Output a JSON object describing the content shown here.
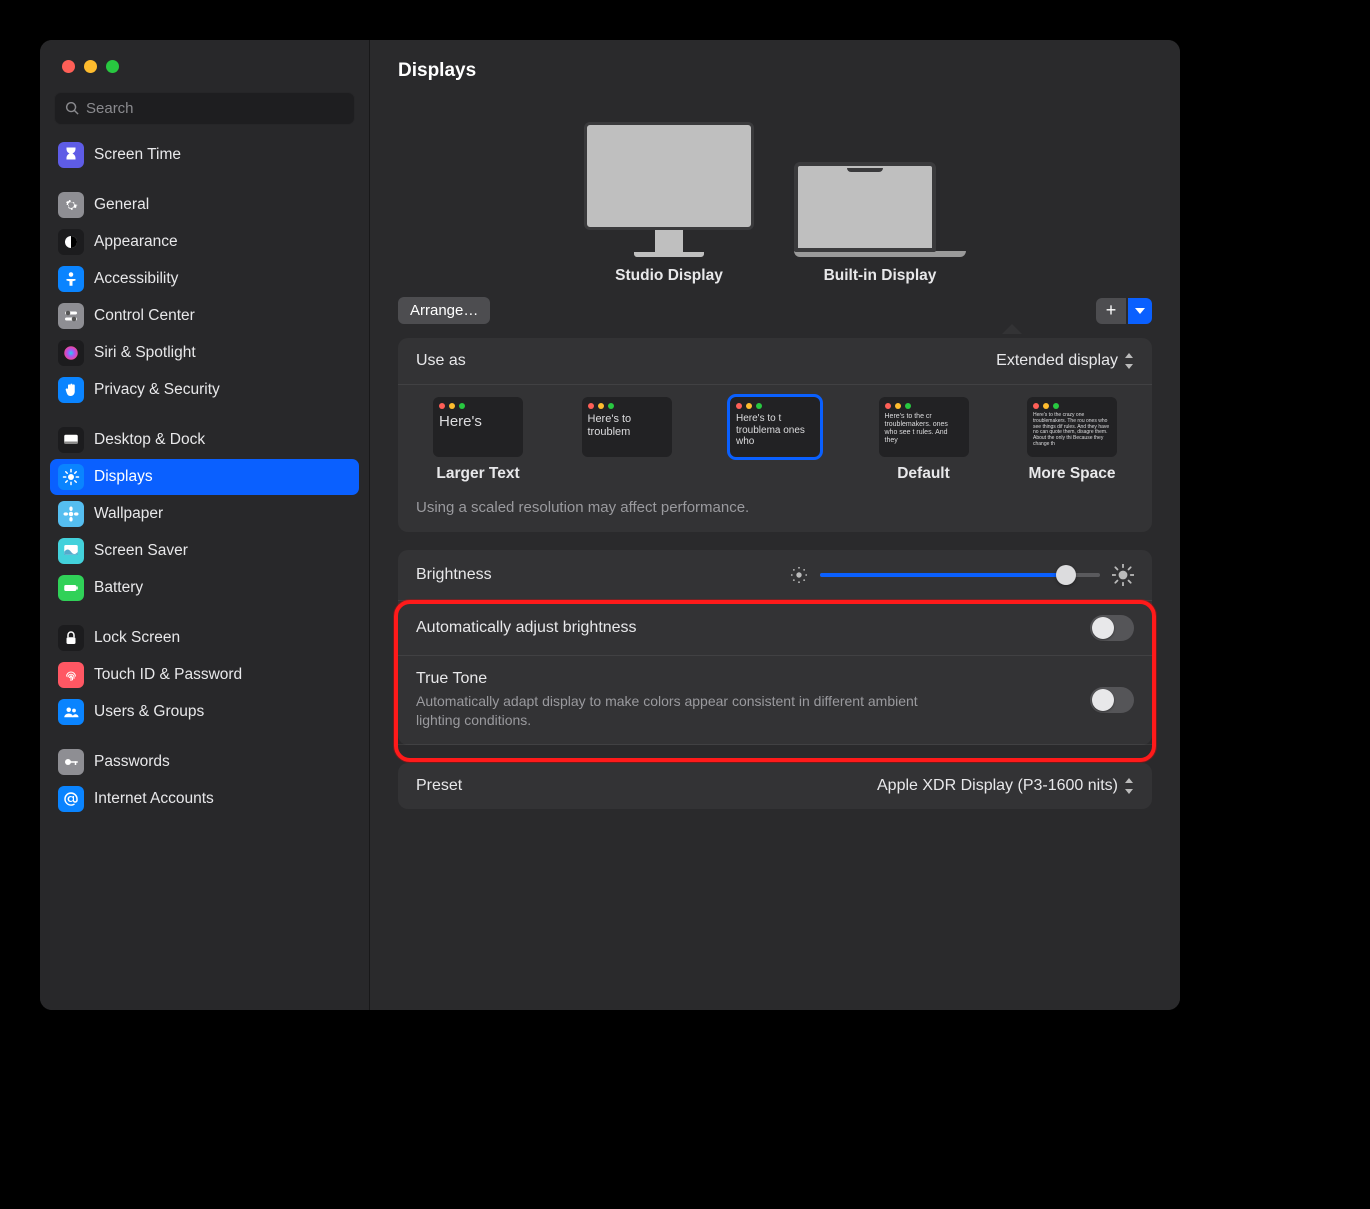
{
  "window": {
    "title": "Displays"
  },
  "search": {
    "placeholder": "Search"
  },
  "sidebar": {
    "groups": [
      {
        "items": [
          {
            "label": "Screen Time",
            "icon": "hourglass",
            "bg": "#5e5ce6"
          }
        ]
      },
      {
        "items": [
          {
            "label": "General",
            "icon": "gear",
            "bg": "#8e8e93"
          },
          {
            "label": "Appearance",
            "icon": "contrast",
            "bg": "#1c1c1e"
          },
          {
            "label": "Accessibility",
            "icon": "figure",
            "bg": "#0a84ff"
          },
          {
            "label": "Control Center",
            "icon": "switches",
            "bg": "#8e8e93"
          },
          {
            "label": "Siri & Spotlight",
            "icon": "siri",
            "bg": "#1c1c1e"
          },
          {
            "label": "Privacy & Security",
            "icon": "hand",
            "bg": "#0a84ff"
          }
        ]
      },
      {
        "items": [
          {
            "label": "Desktop & Dock",
            "icon": "dock",
            "bg": "#1c1c1e"
          },
          {
            "label": "Displays",
            "icon": "brightness",
            "bg": "#0a84ff",
            "selected": true
          },
          {
            "label": "Wallpaper",
            "icon": "flower",
            "bg": "#55bef0"
          },
          {
            "label": "Screen Saver",
            "icon": "screensaver",
            "bg": "#43d1db"
          },
          {
            "label": "Battery",
            "icon": "battery",
            "bg": "#30d158"
          }
        ]
      },
      {
        "items": [
          {
            "label": "Lock Screen",
            "icon": "lock",
            "bg": "#1c1c1e"
          },
          {
            "label": "Touch ID & Password",
            "icon": "fingerprint",
            "bg": "#ff5763"
          },
          {
            "label": "Users & Groups",
            "icon": "users",
            "bg": "#0a84ff"
          }
        ]
      },
      {
        "items": [
          {
            "label": "Passwords",
            "icon": "key",
            "bg": "#8e8e93"
          },
          {
            "label": "Internet Accounts",
            "icon": "at",
            "bg": "#0a84ff"
          }
        ]
      }
    ]
  },
  "displays": {
    "arrange": "Arrange…",
    "items": [
      {
        "name": "Studio Display",
        "type": "monitor"
      },
      {
        "name": "Built-in Display",
        "type": "laptop",
        "selected": true
      }
    ],
    "useAs": {
      "label": "Use as",
      "value": "Extended display"
    },
    "resolutions": {
      "options": [
        {
          "text": "Here's",
          "label": "Larger Text",
          "fs": 15
        },
        {
          "text": "Here's to troublem",
          "label": "",
          "fs": 11
        },
        {
          "text": "Here's to t troublema ones who",
          "label": "",
          "fs": 10,
          "selected": true
        },
        {
          "text": "Here's to the cr troublemakers. ones who see t rules. And they",
          "label": "Default",
          "fs": 7
        },
        {
          "text": "Here's to the crazy one troublemakers. The rou ones who see things dif rules. And they have no can quote them, disagre them. About the only thi Because they change th",
          "label": "More Space",
          "fs": 5
        }
      ],
      "hint": "Using a scaled resolution may affect performance."
    },
    "brightness": {
      "label": "Brightness",
      "value": 88
    },
    "autoBrightness": {
      "label": "Automatically adjust brightness",
      "on": false
    },
    "trueTone": {
      "label": "True Tone",
      "desc": "Automatically adapt display to make colors appear consistent in different ambient lighting conditions.",
      "on": false
    },
    "preset": {
      "label": "Preset",
      "value": "Apple XDR Display (P3-1600 nits)"
    }
  }
}
